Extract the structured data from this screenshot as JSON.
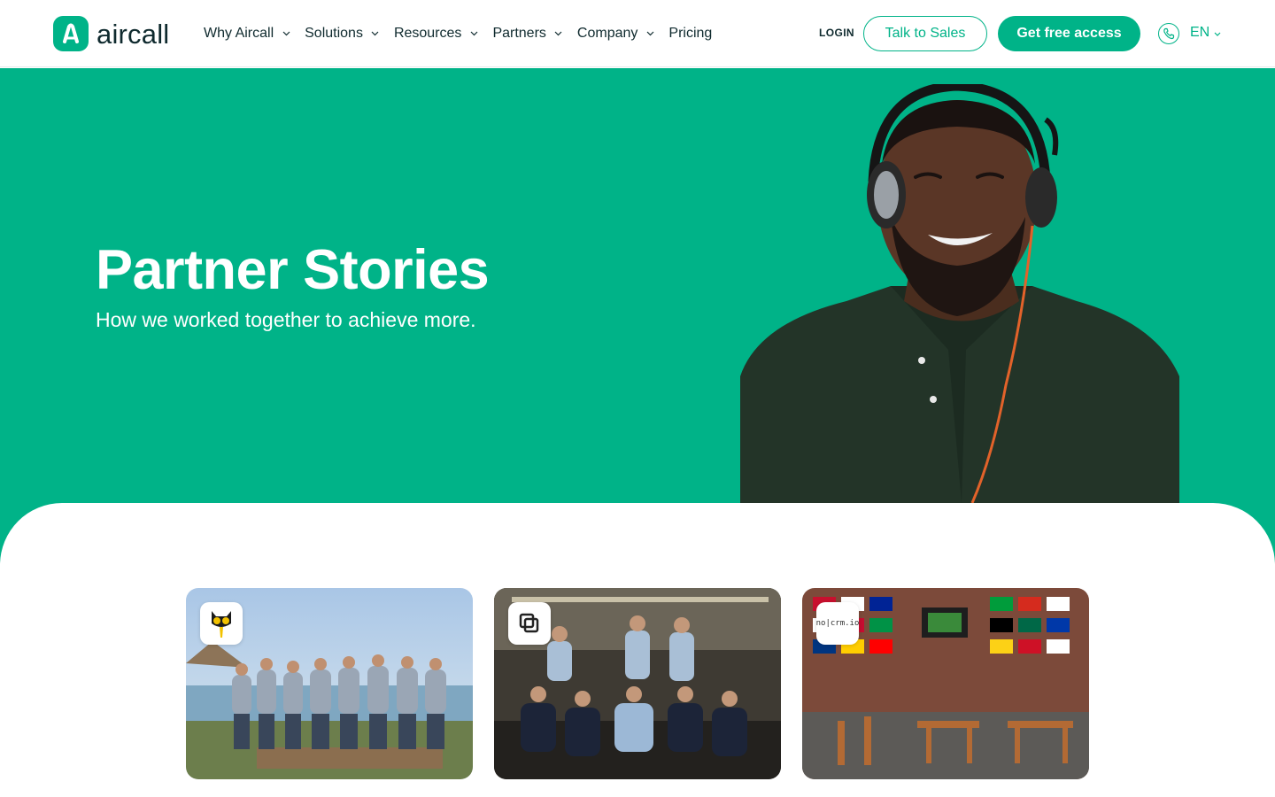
{
  "header": {
    "logo_text": "aircall",
    "nav": [
      {
        "label": "Why Aircall",
        "has_dropdown": true
      },
      {
        "label": "Solutions",
        "has_dropdown": true
      },
      {
        "label": "Resources",
        "has_dropdown": true
      },
      {
        "label": "Partners",
        "has_dropdown": true
      },
      {
        "label": "Company",
        "has_dropdown": true
      },
      {
        "label": "Pricing",
        "has_dropdown": false
      }
    ],
    "login_label": "LOGIN",
    "talk_to_sales_label": "Talk to Sales",
    "get_free_access_label": "Get free access",
    "language": "EN"
  },
  "hero": {
    "title": "Partner Stories",
    "subtitle": "How we worked together to achieve more."
  },
  "cards": [
    {
      "logo_icon": "cat-glasses-icon"
    },
    {
      "logo_icon": "overlapping-squares-icon"
    },
    {
      "logo_text": "no|crm.io"
    }
  ],
  "colors": {
    "brand_green": "#00b388",
    "text_dark": "#0f2a2e",
    "white": "#ffffff"
  }
}
